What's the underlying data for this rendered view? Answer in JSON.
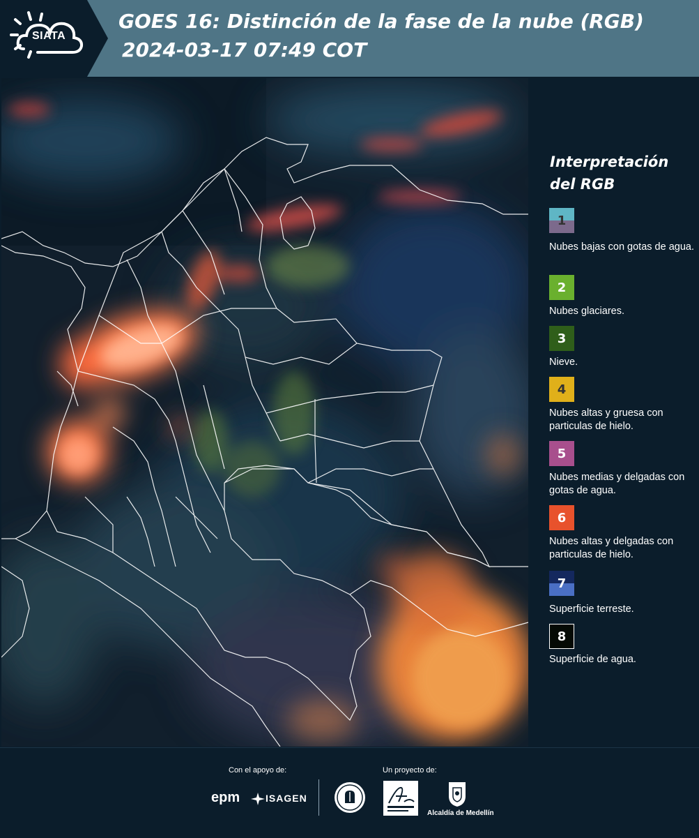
{
  "header": {
    "logo_text": "SIATA",
    "title_line1": "GOES 16: Distinción de la fase de la nube (RGB)",
    "title_line2": "2024-03-17 07:49 COT",
    "colors": {
      "bar": "#4f7586",
      "logo_bg": "#0b1d2b"
    }
  },
  "legend": {
    "title_line1": "Interpretación",
    "title_line2": "del RGB",
    "items": [
      {
        "number": "1",
        "label": "Nubes bajas con gotas de agua.",
        "color_top": "#5fb6c5",
        "color_bottom": "#7c6a8c",
        "text_color": "#333333"
      },
      {
        "number": "2",
        "label": "Nubes glaciares.",
        "color": "#6ab02e",
        "text_color": "#ffffff"
      },
      {
        "number": "3",
        "label": "Nieve.",
        "color": "#2f5e1a",
        "text_color": "#ffffff"
      },
      {
        "number": "4",
        "label": "Nubes altas y gruesa con particulas de hielo.",
        "color": "#e0b01a",
        "text_color": "#333333"
      },
      {
        "number": "5",
        "label": "Nubes medias y delgadas con gotas de agua.",
        "color": "#a84f8d",
        "text_color": "#ffffff"
      },
      {
        "number": "6",
        "label": "Nubes altas y delgadas con particulas de hielo.",
        "color": "#e8522c",
        "text_color": "#ffffff"
      },
      {
        "number": "7",
        "label": "Superficie terreste.",
        "color_top": "#14285e",
        "color_bottom": "#4a6fc4",
        "text_color": "#ffffff"
      },
      {
        "number": "8",
        "label": "Superficie de agua.",
        "color": "#050a05",
        "text_color": "#ffffff",
        "border": "#ffffff"
      }
    ]
  },
  "footer": {
    "support_label": "Con el apoyo de:",
    "project_label": "Un proyecto de:",
    "sponsors": [
      "epm",
      "ISAGEN"
    ],
    "partners": [
      "Área Metropolitana Valle de Aburrá",
      "Alcaldía de Medellín"
    ],
    "alcaldia_text": "Alcaldía de Medellín"
  }
}
